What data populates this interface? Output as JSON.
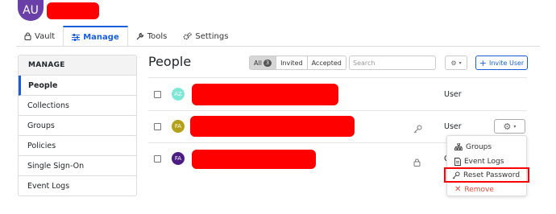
{
  "header": {
    "avatar_initials": "AU"
  },
  "tabs": [
    {
      "label": "Vault",
      "icon": "lock-icon"
    },
    {
      "label": "Manage",
      "icon": "sliders-icon",
      "active": true
    },
    {
      "label": "Tools",
      "icon": "wrench-icon"
    },
    {
      "label": "Settings",
      "icon": "gears-icon"
    }
  ],
  "sidebar": {
    "title": "MANAGE",
    "items": [
      "People",
      "Collections",
      "Groups",
      "Policies",
      "Single Sign-On",
      "Event Logs"
    ],
    "active": "People"
  },
  "main": {
    "title": "People",
    "filters": {
      "all": "All",
      "all_count": "3",
      "invited": "Invited",
      "accepted": "Accepted"
    },
    "search_placeholder": "Search",
    "invite_label": "Invite User"
  },
  "users": [
    {
      "initials": "AZ",
      "avatar_color": "#7ee8d4",
      "role": "User"
    },
    {
      "initials": "FA",
      "avatar_color": "#b3a11a",
      "role": "User"
    },
    {
      "initials": "FA",
      "avatar_color": "#4b1c82",
      "role": "C"
    }
  ],
  "row_menu": {
    "items": [
      {
        "label": "Groups",
        "icon": "sitemap-icon"
      },
      {
        "label": "Event Logs",
        "icon": "file-icon"
      },
      {
        "label": "Reset Password",
        "icon": "key-icon",
        "highlighted": true
      },
      {
        "label": "Remove",
        "icon": "close-icon",
        "danger": true
      }
    ]
  },
  "colors": {
    "accent": "#175ddc",
    "redaction": "#ff0000",
    "danger": "#dd4b39"
  }
}
